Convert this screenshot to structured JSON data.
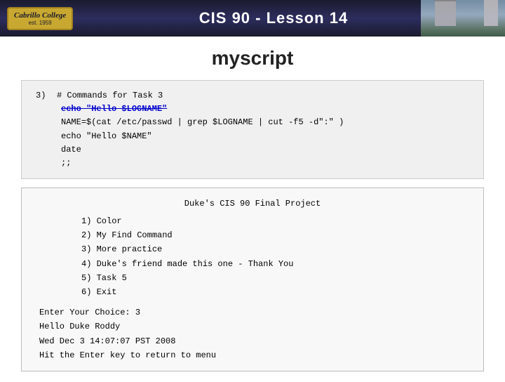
{
  "header": {
    "title": "CIS 90 - Lesson 14",
    "logo_line1": "Cabrillo College",
    "logo_line2": "est. 1959"
  },
  "page": {
    "title": "myscript"
  },
  "code_block_1": {
    "line_num": "3)",
    "comment": "# Commands for Task 3",
    "strikethrough_line": "echo \"Hello $LOGNAME\"",
    "line3": "NAME=$(cat /etc/passwd | grep $LOGNAME | cut -f5 -d\":\" )",
    "line4": "echo \"Hello $NAME\"",
    "line5": "date",
    "line6": ";;"
  },
  "code_block_2": {
    "menu_title": "Duke's CIS 90 Final Project",
    "items": [
      {
        "num": "1)",
        "text": "Color"
      },
      {
        "num": "2)",
        "text": "My Find Command"
      },
      {
        "num": "3)",
        "text": "More practice"
      },
      {
        "num": "4)",
        "text": "Duke's friend made this one - Thank You"
      },
      {
        "num": "5)",
        "text": "Task 5"
      },
      {
        "num": "6)",
        "text": "Exit"
      }
    ],
    "footer": {
      "line1": "Enter Your Choice: 3",
      "line2": "Hello Duke Roddy",
      "line3": "Wed Dec  3 14:07:07 PST 2008",
      "line4": "Hit the Enter key to return to menu"
    }
  }
}
